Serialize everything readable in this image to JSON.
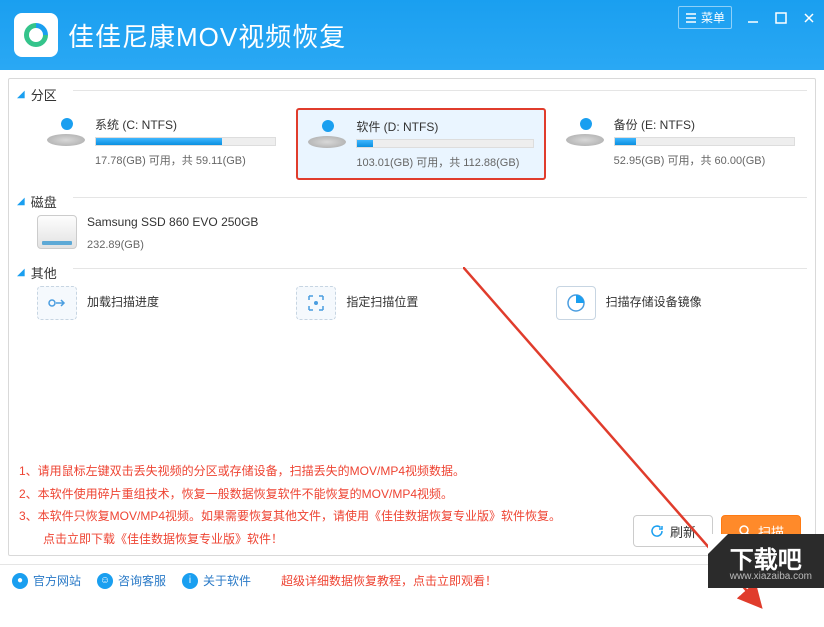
{
  "header": {
    "title": "佳佳尼康MOV视频恢复",
    "menu_label": "菜单"
  },
  "sections": {
    "partitions": "分区",
    "disks": "磁盘",
    "others": "其他"
  },
  "drives": {
    "c": {
      "name": "系统 (C: NTFS)",
      "stat": "17.78(GB) 可用，共 59.11(GB)",
      "fill": 70
    },
    "d": {
      "name": "软件 (D: NTFS)",
      "stat": "103.01(GB) 可用，共 112.88(GB)",
      "fill": 9
    },
    "e": {
      "name": "备份 (E: NTFS)",
      "stat": "52.95(GB) 可用，共 60.00(GB)",
      "fill": 12
    }
  },
  "disk": {
    "name": "Samsung SSD 860 EVO 250GB",
    "size": "232.89(GB)"
  },
  "others": {
    "load": "加载扫描进度",
    "path": "指定扫描位置",
    "image": "扫描存储设备镜像"
  },
  "notes": {
    "l1": "1、请用鼠标左键双击丢失视频的分区或存储设备，扫描丢失的MOV/MP4视频数据。",
    "l2": "2、本软件使用碎片重组技术，恢复一般数据恢复软件不能恢复的MOV/MP4视频。",
    "l3": "3、本软件只恢复MOV/MP4视频。如果需要恢复其他文件，请使用《佳佳数据恢复专业版》软件恢复。",
    "l4": "点击立即下载《佳佳数据恢复专业版》软件！"
  },
  "actions": {
    "refresh": "刷新",
    "scan": "扫描"
  },
  "statusbar": {
    "site": "官方网站",
    "support": "咨询客服",
    "about": "关于软件",
    "tutorial": "超级详细数据恢复教程，点击立即观看！"
  },
  "download_badge": {
    "main": "下载吧",
    "sub": "www.xiazaiba.com"
  }
}
